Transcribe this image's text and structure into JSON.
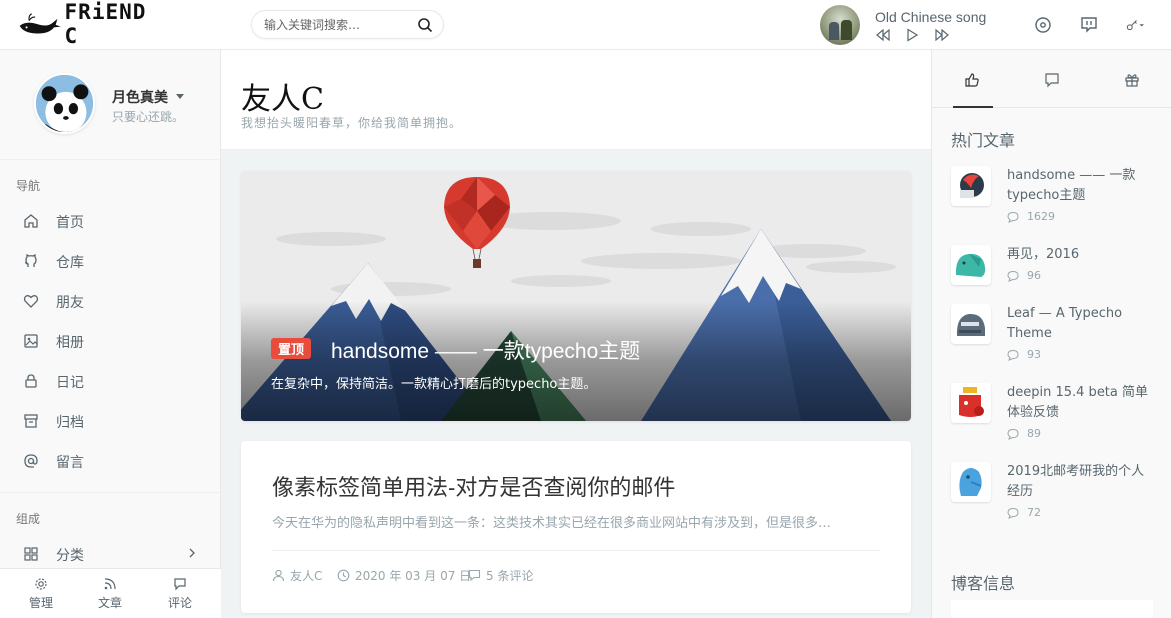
{
  "header": {
    "logo_text": "FRiEND C",
    "search_placeholder": "输入关键词搜索…",
    "song_title": "Old Chinese song"
  },
  "aside": {
    "user_name": "月色真美",
    "user_motto": "只要心还跳。",
    "nav_heading": "导航",
    "nav_items": [
      {
        "label": "首页",
        "icon": "home-icon"
      },
      {
        "label": "仓库",
        "icon": "github-icon"
      },
      {
        "label": "朋友",
        "icon": "heart-icon"
      },
      {
        "label": "相册",
        "icon": "image-icon"
      },
      {
        "label": "日记",
        "icon": "lock-icon"
      },
      {
        "label": "归档",
        "icon": "archive-icon"
      },
      {
        "label": "留言",
        "icon": "at-icon"
      }
    ],
    "compose_heading": "组成",
    "category_label": "分类",
    "footer": [
      {
        "label": "管理",
        "icon": "gear-icon"
      },
      {
        "label": "文章",
        "icon": "rss-icon"
      },
      {
        "label": "评论",
        "icon": "comment-icon"
      }
    ]
  },
  "main": {
    "blog_title": "友人C",
    "blog_subtitle": "我想抬头暖阳春草，你给我简单拥抱。",
    "hero": {
      "badge": "置顶",
      "title": "handsome —— 一款typecho主题",
      "excerpt": "在复杂中，保持简洁。一款精心打磨后的typecho主题。"
    },
    "post": {
      "title": "像素标签简单用法-对方是否查阅你的邮件",
      "excerpt": "今天在华为的隐私声明中看到这一条：这类技术其实已经在很多商业网站中有涉及到，但是很多…",
      "author": "友人C",
      "date": "2020 年 03 月 07 日",
      "comments": "5 条评论"
    }
  },
  "right": {
    "hot_title": "热门文章",
    "hot_items": [
      {
        "title": "handsome —— 一款typecho主题",
        "count": "1629"
      },
      {
        "title": "再见，2016",
        "count": "96"
      },
      {
        "title": "Leaf — A Typecho Theme",
        "count": "93"
      },
      {
        "title": "deepin 15.4 beta 简单体验反馈",
        "count": "89"
      },
      {
        "title": "2019北邮考研我的个人经历",
        "count": "72"
      }
    ],
    "blog_info_title": "博客信息"
  },
  "colors": {
    "badge": "#e74c3c",
    "mountain_blue": "#3b5f99",
    "balloon_red": "#d63a2f"
  }
}
